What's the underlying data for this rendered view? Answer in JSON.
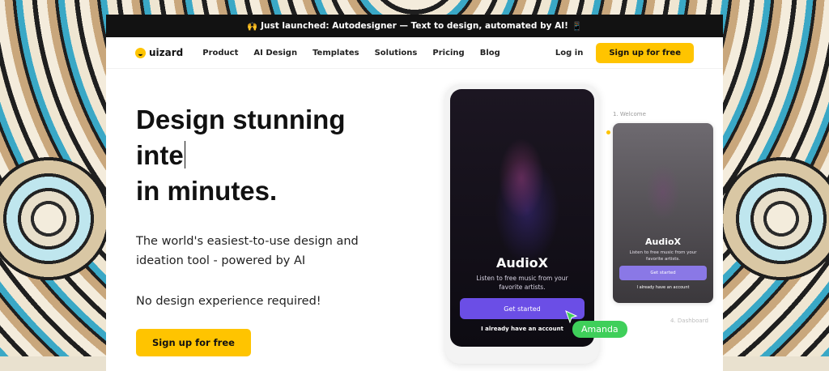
{
  "announcement": {
    "emoji": "🙌",
    "text": "Just launched: Autodesigner — Text to design, automated by AI!",
    "trailing_icon": "📱"
  },
  "nav": {
    "logo": "uizard",
    "items": [
      "Product",
      "AI Design",
      "Templates",
      "Solutions",
      "Pricing",
      "Blog"
    ],
    "login": "Log in",
    "signup": "Sign up for free"
  },
  "hero": {
    "headline_line1": "Design stunning",
    "headline_line2": "inte",
    "headline_line3": "in minutes.",
    "subtitle_line1": "The world's easiest-to-use design and",
    "subtitle_line2": "ideation tool - powered by AI",
    "note": "No design experience required!",
    "cta": "Sign up for free"
  },
  "mockup": {
    "label_welcome": "1. Welcome",
    "label_dashboard": "4. Dashboard",
    "app_title": "AudioX",
    "app_desc": "Listen to free music from your favorite artists.",
    "get_started": "Get started",
    "have_account": "I already have an account",
    "cursor_user": "Amanda"
  },
  "colors": {
    "accent": "#ffc400",
    "button_purple": "#6b4ee6",
    "cursor_green": "#3fcf5a"
  }
}
